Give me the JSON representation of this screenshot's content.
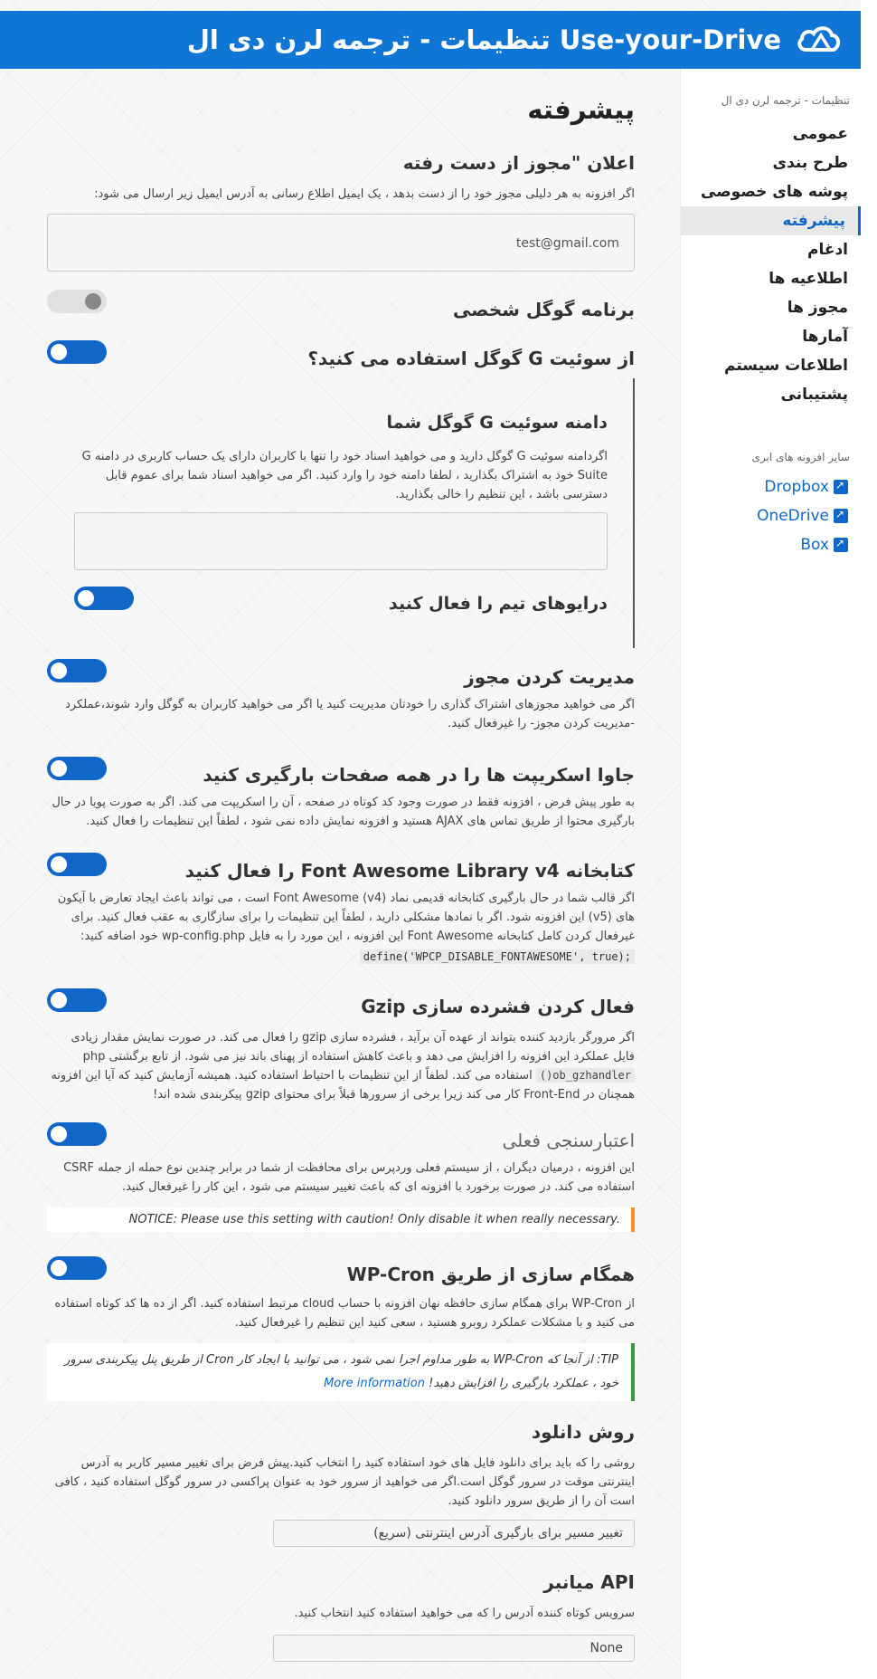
{
  "header": {
    "title": "Use-your-Drive تنظیمات - ترجمه لرن دی ال"
  },
  "sidebar": {
    "subtitle": "تنظیمات - ترجمه لرن دی ال",
    "items": [
      "عمومی",
      "طرح بندی",
      "پوشه های خصوصی",
      "پیشرفته",
      "ادغام",
      "اطلاعیه ها",
      "مجوز ها",
      "آمارها",
      "اطلاعات سیستم",
      "پشتیبانی"
    ],
    "active_index": 3,
    "other_plugins_label": "سایر افزونه های ابری",
    "plugins": [
      "Dropbox",
      "OneDrive",
      "Box"
    ]
  },
  "main": {
    "page_title": "پیشرفته",
    "lost_license": {
      "title": "اعلان \"مجوز از دست رفته",
      "desc": "اگر افزونه به هر دلیلی مجوز خود را از دست بدهد ، یک ایمیل اطلاع رسانی به آدرس ایمیل زیر ارسال می شود:",
      "email_value": "test@gmail.com"
    },
    "personal_google": {
      "title": "برنامه گوگل شخصی",
      "on": false
    },
    "gsuite": {
      "title": "از سوئیت G گوگل استفاده می کنید؟",
      "on": true,
      "domain_title": "دامنه سوئیت G گوگل شما",
      "domain_desc": "اگردامنه سوئیت G گوگل دارید و می خواهید اسناد خود را تنها با کاربران دارای یک حساب کاربری در دامنه G Suite خود به اشتراک بگذارید ، لطفا دامنه خود را وارد کنید. اگر می خواهید اسناد شما برای عموم قابل دسترسی باشد ، این تنظیم را خالی بگذارید.",
      "domain_value": "",
      "team_drives_title": "درایوهای تیم را فعال کنید",
      "team_drives_on": true
    },
    "manage_permissions": {
      "title": "مدیریت کردن مجوز",
      "on": true,
      "desc": "اگر می خواهید مجوزهای اشتراک گذاری را خودتان مدیریت کنید یا اگر می خواهید کاربران به گوگل وارد شوند،عملکرد -مدیریت کردن مجوز- را غیرفعال کنید."
    },
    "load_js": {
      "title": "جاوا اسکریپت ها را در همه صفحات بارگیری کنید",
      "on": true,
      "desc": "به طور پیش فرض ، افزونه فقط در صورت وجود کد کوتاه در صفحه ، آن را اسکریپت می کند. اگر به صورت پویا در حال بارگیری محتوا از طریق تماس های AJAX هستید و افزونه نمایش داده نمی شود ، لطفاً این تنظیمات را فعال کنید."
    },
    "font_awesome": {
      "title": "کتابخانه Font Awesome Library v4 را فعال کنید",
      "on": true,
      "desc": "اگر قالب شما در حال بارگیری کتابخانه قدیمی نماد Font Awesome (v4) است ، می تواند باعث ایجاد تعارض با آیکون های (v5) این افزونه شود. اگر با نمادها مشکلی دارید ، لطفاً این تنظیمات را برای سازگاری به عقب فعال کنید. برای غیرفعال کردن کامل کتابخانه Font Awesome این افزونه ، این مورد را به فایل wp-config.php خود اضافه کنید:",
      "code": "define('WPCP_DISABLE_FONTAWESOME', true);"
    },
    "gzip": {
      "title": "فعال کردن فشرده سازی Gzip",
      "on": true,
      "desc_1": "اگر مرورگر بازدید کننده بتواند از عهده آن برآید ، فشرده سازی gzip را فعال می کند. در صورت نمایش مقدار زیادی فایل عملکرد این افزونه را افزایش می دهد و باعث کاهش استفاده از پهنای باند نیز می شود. از تابع برگشتی php",
      "code": "ob_gzhandler()",
      "desc_2": "استفاده می کند. لطفاً از این تنظیمات با احتیاط استفاده کنید. همیشه آزمایش کنید که آیا این افزونه همچنان در Front-End کار می کند زیرا برخی از سرورها قبلاً برای محتوای gzip پیکربندی شده اند!"
    },
    "nonce": {
      "title": "اعتبارسنجی فعلی",
      "on": true,
      "desc": "این افزونه ، درمیان دیگران ، از سیستم فعلی وردپرس برای محافظت از شما در برابر چندین نوع حمله از جمله CSRF استفاده می کند. در صورت برخورد با افزونه ای که باعث تغییر سیستم می شود ، این کار را غیرفعال کنید.",
      "notice": "NOTICE: Please use this setting with caution! Only disable it when really necessary."
    },
    "wp_cron": {
      "title": "همگام سازی از طریق WP-Cron",
      "on": true,
      "desc": "از WP-Cron برای همگام سازی حافظه نهان افزونه با حساب cloud مرتبط استفاده کنید. اگر از ده ها کد کوتاه استفاده می کنید و با مشکلات عملکرد روبرو هستید ، سعی کنید این تنظیم را غیرفعال کنید.",
      "tip": "TIP: از آنجا که WP-Cron به طور مداوم اجرا نمی شود ، می توانید با ایجاد کار Cron از طریق پنل پیکربندی سرور خود ، عملکرد بارگیری را افزایش دهید!",
      "tip_link": "More information"
    },
    "download_method": {
      "title": "روش دانلود",
      "desc": "روشی را که باید برای دانلود فایل های خود استفاده کنید را انتخاب کنید.پیش فرض برای تغییر مسیر کاربر به آدرس اینترنتی موقت در سرور گوگل است.اگر می خواهید از سرور خود به عنوان پراکسی در سرور گوگل استفاده کنید ، کافی است آن را از طریق سرور دانلود کنید.",
      "selected": "تغییر مسیر برای بارگیری آدرس اینترنتی (سریع)"
    },
    "api_shortener": {
      "title": "API میانبر",
      "desc": "سرویس کوتاه کننده آدرس را که می خواهید استفاده کنید انتخاب کنید.",
      "selected": "None"
    }
  },
  "colors": {
    "brand": "#0f76d6",
    "link": "#1167c8",
    "notice": "#f7931e",
    "tip": "#2e9e3f"
  }
}
